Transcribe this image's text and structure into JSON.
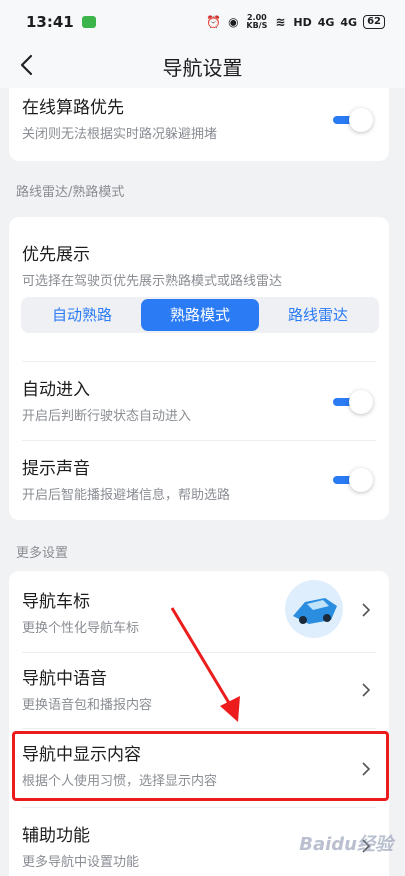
{
  "status": {
    "time": "13:41",
    "speed_top": "2.00",
    "speed_bottom": "KB/S",
    "network": "HD",
    "signal1": "4G",
    "signal2": "4G",
    "battery": "62"
  },
  "nav": {
    "title": "导航设置"
  },
  "card1": {
    "title": "在线算路优先",
    "subtitle": "关闭则无法根据实时路况躲避拥堵"
  },
  "section1": {
    "label": "路线雷达/熟路模式"
  },
  "card2": {
    "priority": {
      "title": "优先展示",
      "subtitle": "可选择在驾驶页优先展示熟路模式或路线雷达"
    },
    "segments": [
      "自动熟路",
      "熟路模式",
      "路线雷达"
    ],
    "auto_enter": {
      "title": "自动进入",
      "subtitle": "开启后判断行驶状态自动进入"
    },
    "sound": {
      "title": "提示声音",
      "subtitle": "开启后智能播报避堵信息，帮助选路"
    }
  },
  "section2": {
    "label": "更多设置"
  },
  "card3": {
    "car_icon": {
      "title": "导航车标",
      "subtitle": "更换个性化导航车标"
    },
    "voice": {
      "title": "导航中语音",
      "subtitle": "更换语音包和播报内容"
    },
    "display": {
      "title": "导航中显示内容",
      "subtitle": "根据个人使用习惯，选择显示内容"
    },
    "assist": {
      "title": "辅助功能",
      "subtitle": "更多导航中设置功能"
    }
  },
  "watermark": "Baidu经验",
  "colors": {
    "accent": "#2b7bf5",
    "highlight": "#ec1c1c"
  }
}
